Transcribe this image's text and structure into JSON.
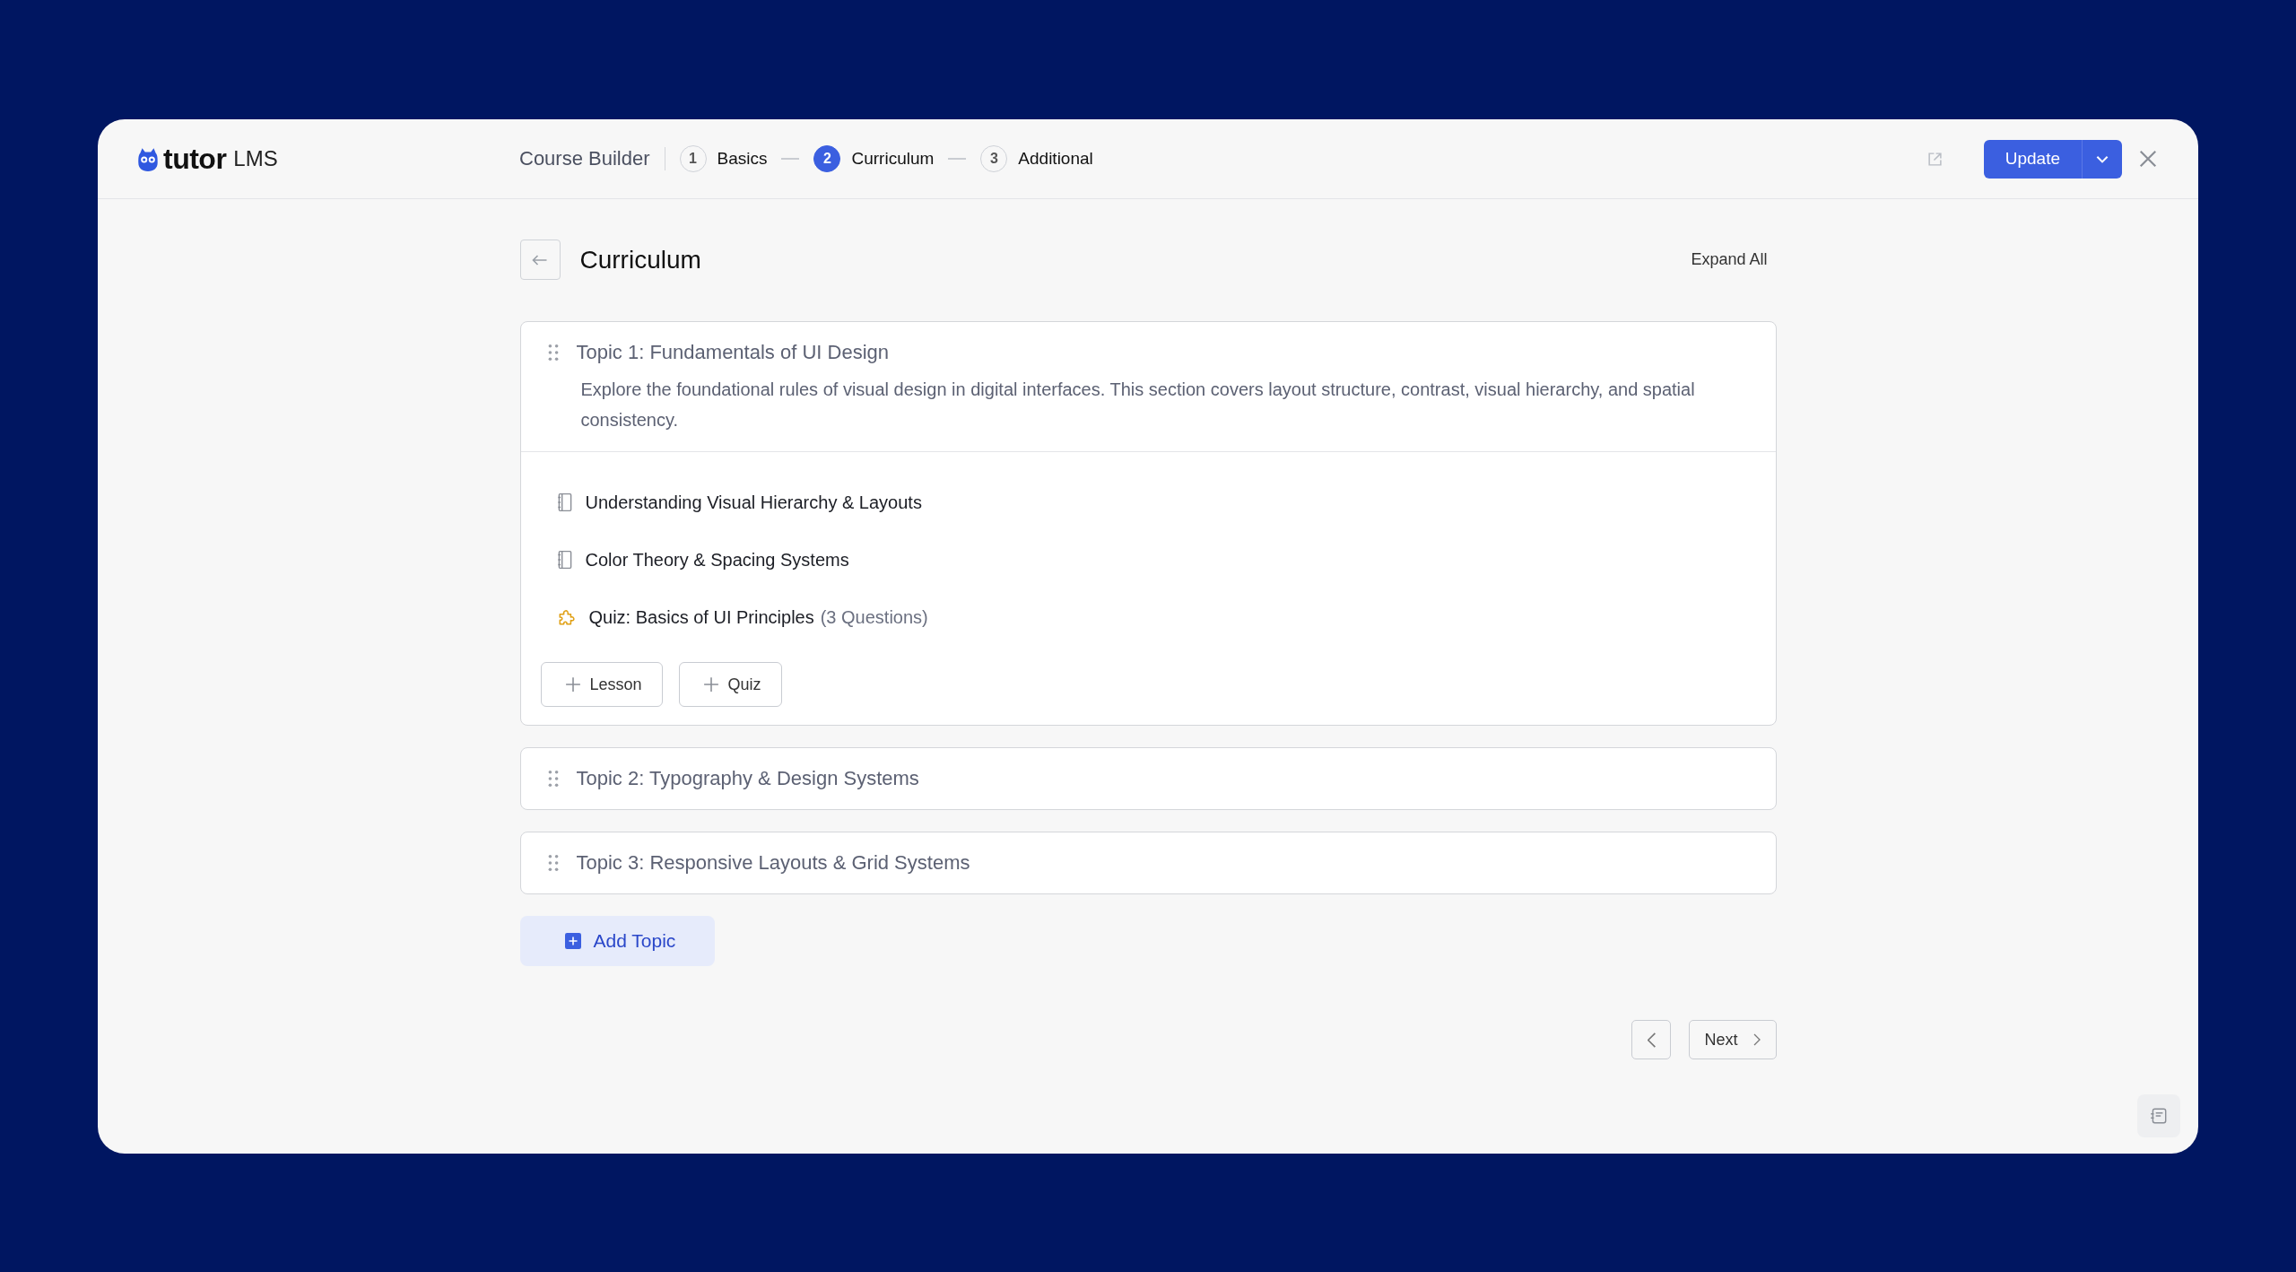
{
  "header": {
    "logo": "tutor",
    "logo_suffix": "LMS",
    "builder_label": "Course Builder",
    "steps": [
      {
        "number": "1",
        "label": "Basics",
        "selected": false
      },
      {
        "number": "2",
        "label": "Curriculum",
        "selected": true
      },
      {
        "number": "3",
        "label": "Additional",
        "selected": false
      }
    ],
    "update_button": "Update"
  },
  "page": {
    "title": "Curriculum",
    "expand_all": "Expand All"
  },
  "topics": [
    {
      "title": "Topic 1: Fundamentals of UI Design",
      "expanded": true,
      "description": "Explore the foundational rules of visual design in digital interfaces. This section covers layout structure, contrast, visual hierarchy, and spatial consistency.",
      "items": [
        {
          "kind": "lesson",
          "title": "Understanding Visual Hierarchy & Layouts"
        },
        {
          "kind": "lesson",
          "title": "Color Theory & Spacing Systems"
        },
        {
          "kind": "quiz",
          "title": "Quiz: Basics of UI Principles",
          "count": "(3 Questions)"
        }
      ],
      "buttons": [
        "Lesson",
        "Quiz"
      ]
    },
    {
      "title": "Topic 2: Typography & Design Systems",
      "expanded": false
    },
    {
      "title": "Topic 3: Responsive Layouts & Grid Systems",
      "expanded": false
    }
  ],
  "add_topic": "Add Topic",
  "footer": {
    "next": "Next"
  }
}
